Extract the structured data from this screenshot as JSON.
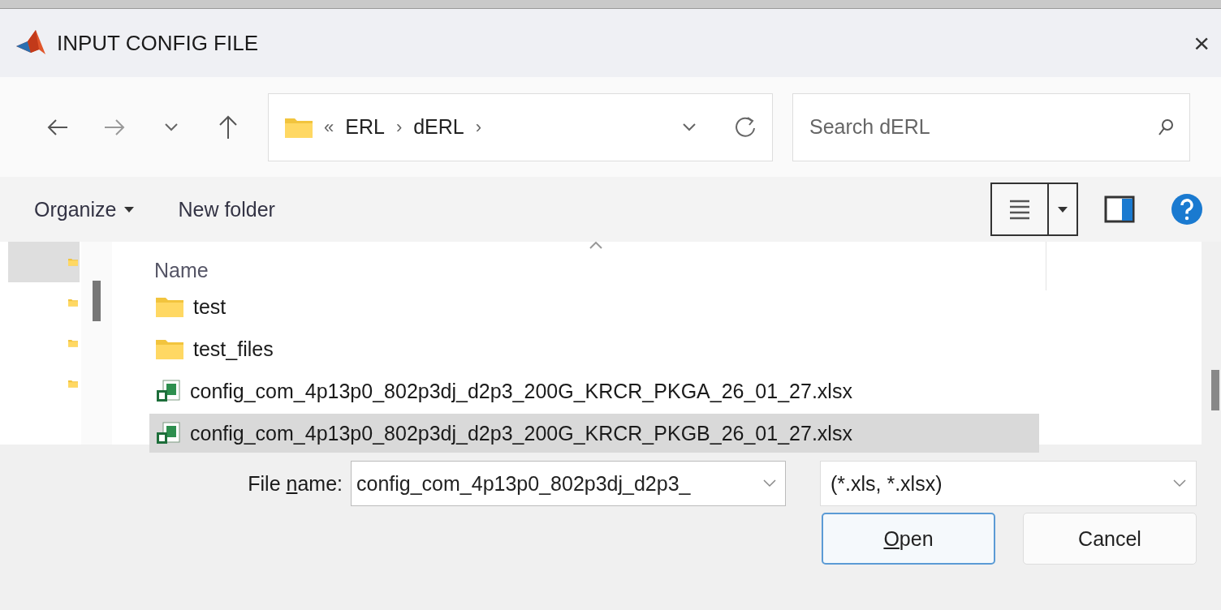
{
  "window": {
    "title": "INPUT CONFIG FILE",
    "close": "×"
  },
  "navigation": {
    "breadcrumb_prefix": "«",
    "path": [
      {
        "label": "ERL"
      },
      {
        "label": "dERL"
      }
    ],
    "separator": "›"
  },
  "search": {
    "placeholder": "Search dERL"
  },
  "toolbar": {
    "organize": "Organize",
    "new_folder": "New folder"
  },
  "sidebar": {
    "items": [
      {
        "selected": true
      },
      {
        "selected": false
      },
      {
        "selected": false
      },
      {
        "selected": false
      }
    ]
  },
  "file_list": {
    "columns": [
      "Name"
    ],
    "rows": [
      {
        "name": "test",
        "kind": "folder",
        "selected": false
      },
      {
        "name": "test_files",
        "kind": "folder",
        "selected": false
      },
      {
        "name": "config_com_4p13p0_802p3dj_d2p3_200G_KRCR_PKGA_26_01_27.xlsx",
        "kind": "spreadsheet",
        "selected": false
      },
      {
        "name": "config_com_4p13p0_802p3dj_d2p3_200G_KRCR_PKGB_26_01_27.xlsx",
        "kind": "spreadsheet",
        "selected": true
      }
    ]
  },
  "file_name": {
    "label": {
      "before": "File ",
      "key": "n",
      "after": "ame:"
    },
    "value": "config_com_4p13p0_802p3dj_d2p3_"
  },
  "file_type": {
    "value": "(*.xls, *.xlsx)"
  },
  "buttons": [
    {
      "label": {
        "key": "O",
        "after": "pen"
      },
      "kind": "primary"
    },
    {
      "label": {
        "before": "Cancel"
      },
      "kind": "default"
    }
  ]
}
